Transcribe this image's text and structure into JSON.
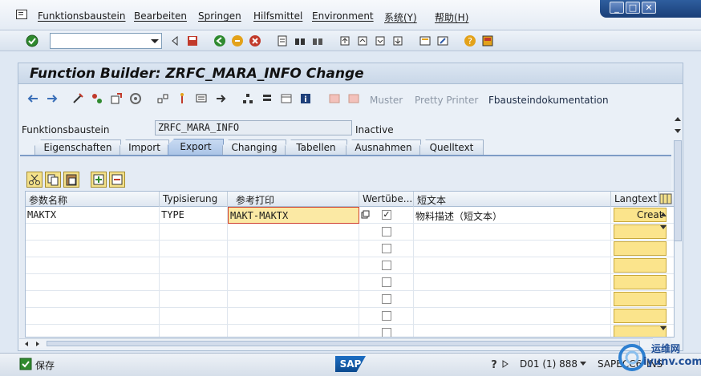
{
  "menu": {
    "items": [
      "Funktionsbaustein",
      "Bearbeiten",
      "Springen",
      "Hilfsmittel",
      "Environment",
      "系统(Y)",
      "帮助(H)"
    ]
  },
  "window_controls": {
    "minimize": "_",
    "maximize": "□",
    "close": "✕"
  },
  "toolbar": {
    "command_field_value": ""
  },
  "header": {
    "title": "Function Builder: ZRFC_MARA_INFO Change"
  },
  "app_toolbar": {
    "muster": "Muster",
    "pretty_printer": "Pretty Printer",
    "doc": "Fbausteindokumentation"
  },
  "form": {
    "label": "Funktionsbaustein",
    "value": "ZRFC_MARA_INFO",
    "status": "Inactive"
  },
  "tabs": [
    "Eigenschaften",
    "Import",
    "Export",
    "Changing",
    "Tabellen",
    "Ausnahmen",
    "Quelltext"
  ],
  "active_tab": "Export",
  "grid": {
    "headers": [
      "参数名称",
      "Typisierung",
      "参考打印",
      "Wertübe...",
      "短文本",
      "Langtext"
    ],
    "rows": [
      {
        "name": "MAKTX",
        "typing": "TYPE",
        "ref": "MAKT-MAKTX",
        "checked": "✓",
        "short_text": "物料描述（短文本）",
        "lang": "Creat"
      },
      {
        "name": "",
        "typing": "",
        "ref": "",
        "checked": "",
        "short_text": "",
        "lang": ""
      },
      {
        "name": "",
        "typing": "",
        "ref": "",
        "checked": "",
        "short_text": "",
        "lang": ""
      },
      {
        "name": "",
        "typing": "",
        "ref": "",
        "checked": "",
        "short_text": "",
        "lang": ""
      },
      {
        "name": "",
        "typing": "",
        "ref": "",
        "checked": "",
        "short_text": "",
        "lang": ""
      },
      {
        "name": "",
        "typing": "",
        "ref": "",
        "checked": "",
        "short_text": "",
        "lang": ""
      },
      {
        "name": "",
        "typing": "",
        "ref": "",
        "checked": "",
        "short_text": "",
        "lang": ""
      },
      {
        "name": "",
        "typing": "",
        "ref": "",
        "checked": "",
        "short_text": "",
        "lang": ""
      }
    ]
  },
  "statusbar": {
    "message": "保存",
    "system": "D01 (1) 888",
    "server": "SAPECC6",
    "mode": "INS",
    "logo": "SAP"
  },
  "watermark": {
    "line1": "运维网",
    "line2": "iyunv.com"
  },
  "colors": {
    "accent": "#7e9cc6",
    "required_field": "#fbe48c",
    "error_border": "#d04030"
  }
}
